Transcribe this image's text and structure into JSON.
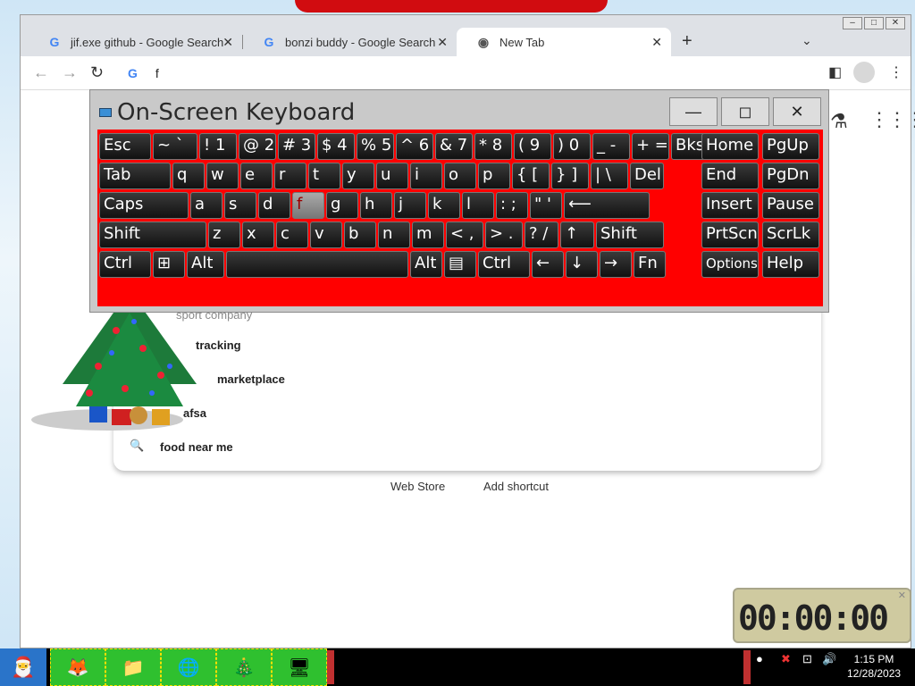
{
  "browser": {
    "tabs": [
      {
        "label": "jif.exe github - Google Search",
        "icon": "google-g-icon"
      },
      {
        "label": "bonzi buddy - Google Search",
        "icon": "google-g-icon"
      },
      {
        "label": "New Tab",
        "icon": "chrome-icon"
      }
    ],
    "new_tab_symbol": "+",
    "tab_list_symbol": "⌄",
    "omnibox_value": "f",
    "suggestions": [
      {
        "text": "sport company",
        "faint": true
      },
      {
        "text": "tracking"
      },
      {
        "text": "marketplace"
      },
      {
        "text": "afsa"
      },
      {
        "text": "food near me"
      }
    ],
    "links": [
      "Web Store",
      "Add shortcut"
    ]
  },
  "osk": {
    "title": "On-Screen Keyboard",
    "rows": [
      [
        "Esc",
        "~ `",
        "! 1",
        "@ 2",
        "# 3",
        "$ 4",
        "% 5",
        "^ 6",
        "& 7",
        "* 8",
        "( 9",
        ") 0",
        "_ -",
        "+ =",
        "Bksp",
        "Home",
        "PgUp"
      ],
      [
        "Tab",
        "q",
        "w",
        "e",
        "r",
        "t",
        "y",
        "u",
        "i",
        "o",
        "p",
        "{ [",
        "} ]",
        "| \\",
        "Del",
        "End",
        "PgDn"
      ],
      [
        "Caps",
        "a",
        "s",
        "d",
        "f",
        "g",
        "h",
        "j",
        "k",
        "l",
        ": ;",
        "\" '",
        "⟵",
        "Insert",
        "Pause"
      ],
      [
        "Shift",
        "z",
        "x",
        "c",
        "v",
        "b",
        "n",
        "m",
        "< ,",
        "> .",
        "? /",
        "↑",
        "Shift",
        "PrtScn",
        "ScrLk"
      ],
      [
        "Ctrl",
        "⊞",
        "Alt",
        "",
        "Alt",
        "▤",
        "Ctrl",
        "←",
        "↓",
        "→",
        "Fn",
        "Options",
        "Help"
      ]
    ],
    "pressed_key": "f"
  },
  "clock": {
    "display": "00:00:00"
  },
  "taskbar": {
    "time": "1:15 PM",
    "date": "12/28/2023"
  }
}
